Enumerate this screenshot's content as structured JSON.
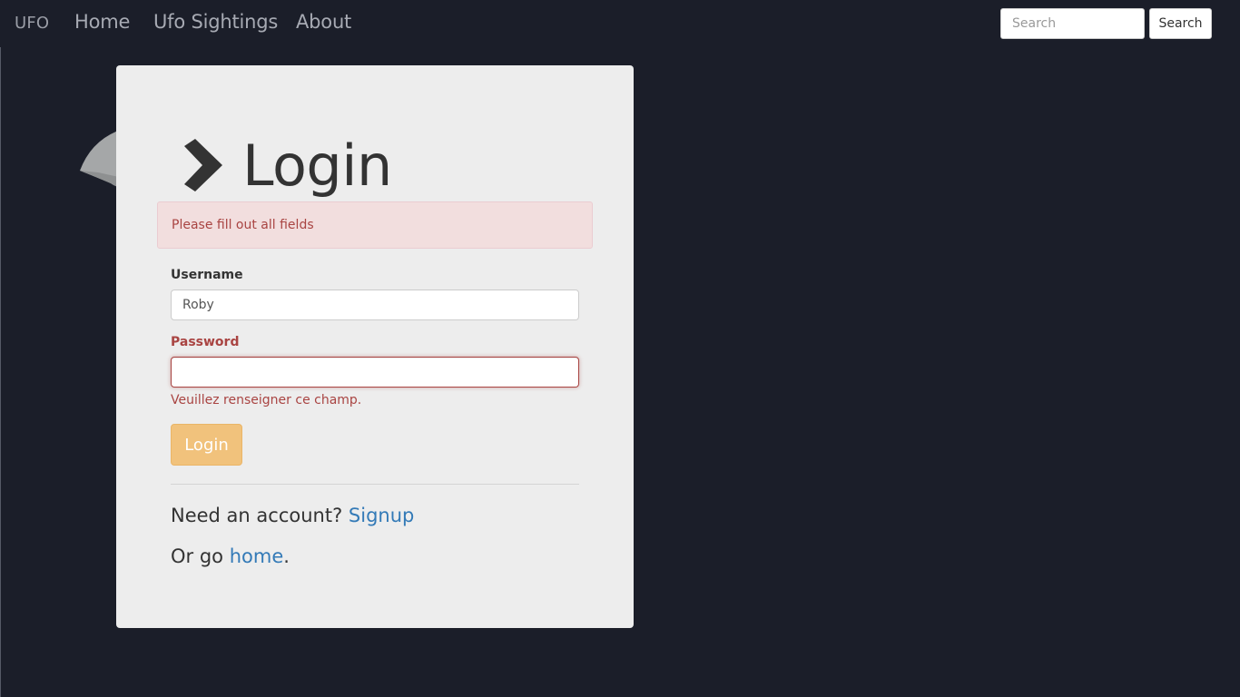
{
  "navbar": {
    "brand": "UFO",
    "links": [
      {
        "label": "Home"
      },
      {
        "label": "Ufo Sightings"
      },
      {
        "label": "About"
      }
    ],
    "search": {
      "placeholder": "Search",
      "value": "",
      "button_label": "Search"
    }
  },
  "login": {
    "title": "Login",
    "alert": "Please fill out all fields",
    "username": {
      "label": "Username",
      "value": "Roby"
    },
    "password": {
      "label": "Password",
      "value": "",
      "validation_message": "Veuillez renseigner ce champ."
    },
    "submit_label": "Login",
    "signup": {
      "prefix": "Need an account?",
      "link_label": "Signup"
    },
    "home": {
      "prefix": "Or go",
      "link_label": "home",
      "suffix": "."
    }
  },
  "colors": {
    "background": "#1b1e29",
    "card": "#ededed",
    "error": "#a94442",
    "alert_bg": "#f2dede",
    "button": "#f1c27c",
    "link": "#337ab7"
  },
  "icons": {
    "title_icon": "chevron-right-icon",
    "background_art": "ufo-icon"
  }
}
